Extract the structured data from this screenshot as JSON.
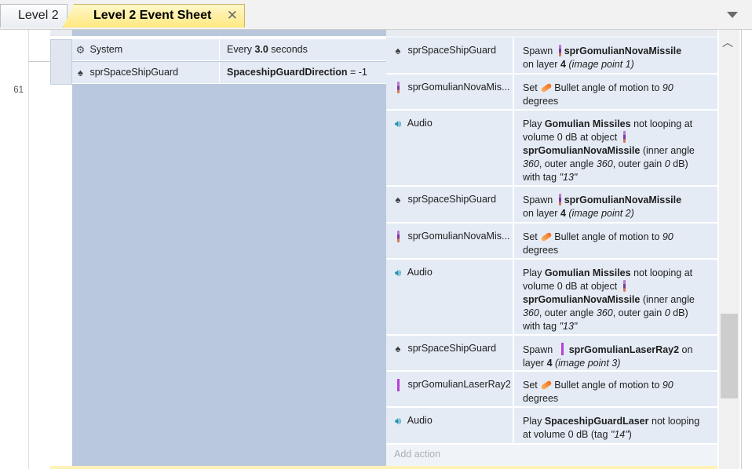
{
  "tabs": [
    {
      "label": "Level 2",
      "active": false
    },
    {
      "label": "Level 2 Event Sheet",
      "active": true
    }
  ],
  "tab_close_icon": "close-icon",
  "line_number": "61",
  "conditions": [
    {
      "object": "System",
      "icon": "gear-icon",
      "text_pre": "Every ",
      "text_bold": "3.0",
      "text_post": " seconds"
    },
    {
      "object": "sprSpaceShipGuard",
      "icon": "spaceship-icon",
      "text_pre": "",
      "text_bold": "SpaceshipGuardDirection",
      "text_post": " = -1"
    }
  ],
  "actions": [
    {
      "object": "sprSpaceShipGuard",
      "icon": "spaceship-icon",
      "line1_pre": "Spawn",
      "line1_bold": "sprGomulianNovaMissile",
      "line2_pre": "on layer ",
      "line2_bold": "4",
      "line2_ital": "(image point 1)"
    },
    {
      "object": "sprGomulianNovaMis...",
      "icon": "missile-icon",
      "pre": "Set",
      "mid": "Bullet angle of motion to",
      "value": "90",
      "post": "degrees"
    },
    {
      "object": "Audio",
      "icon": "speaker-icon",
      "p1": "Play",
      "b1": "Gomulian Missiles",
      "p2": "not looping at volume 0 dB at object",
      "b2": "sprGomulianNovaMissile",
      "p3": "(inner angle",
      "i1": "360",
      "p4": ", outer angle",
      "i2": "360",
      "p5": ", outer gain",
      "i3": "0",
      "p6": "dB) with tag",
      "i4": "\"13\""
    },
    {
      "object": "sprSpaceShipGuard",
      "icon": "spaceship-icon",
      "line1_pre": "Spawn",
      "line1_bold": "sprGomulianNovaMissile",
      "line2_pre": "on layer ",
      "line2_bold": "4",
      "line2_ital": "(image point 2)"
    },
    {
      "object": "sprGomulianNovaMis...",
      "icon": "missile-icon",
      "pre": "Set",
      "mid": "Bullet angle of motion to",
      "value": "90",
      "post": "degrees"
    },
    {
      "object": "Audio",
      "icon": "speaker-icon",
      "p1": "Play",
      "b1": "Gomulian Missiles",
      "p2": "not looping at volume 0 dB at object",
      "b2": "sprGomulianNovaMissile",
      "p3": "(inner angle",
      "i1": "360",
      "p4": ", outer angle",
      "i2": "360",
      "p5": ", outer gain",
      "i3": "0",
      "p6": "dB) with tag",
      "i4": "\"13\""
    },
    {
      "object": "sprSpaceShipGuard",
      "icon": "spaceship-icon",
      "line1_pre": "Spawn",
      "line1_bold": "sprGomulianLaserRay2",
      "line1_post": "on",
      "line2_pre": "layer ",
      "line2_bold": "4",
      "line2_ital": "(image point 3)"
    },
    {
      "object": "sprGomulianLaserRay2",
      "icon": "laser-icon",
      "pre": "Set",
      "mid": "Bullet angle of motion to",
      "value": "90",
      "post": "degrees"
    },
    {
      "object": "Audio",
      "icon": "speaker-icon",
      "p1": "Play",
      "b1": "SpaceshipGuardLaser",
      "p2": "not looping at volume 0 dB (tag",
      "i4": "\"14\"",
      "p6": ")"
    }
  ],
  "add_action_label": "Add action"
}
